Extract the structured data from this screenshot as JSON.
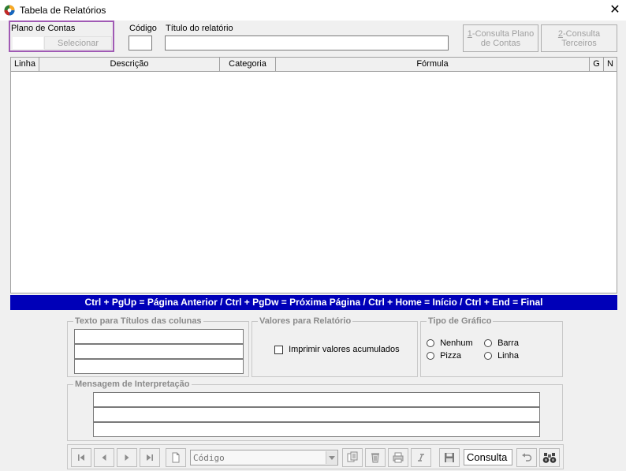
{
  "window": {
    "title": "Tabela de Relatórios",
    "close_glyph": "✕"
  },
  "header": {
    "plano_label": "Plano de Contas",
    "selecionar_label": "Selecionar",
    "codigo_label": "Código",
    "titulo_label": "Título do relatório",
    "codigo_value": "",
    "titulo_value": "",
    "consulta_plano": {
      "hotkey": "1",
      "line1_rest": "-Consulta Plano",
      "line2": "de Contas"
    },
    "consulta_terceiros": {
      "hotkey": "2",
      "line1_rest": "-Consulta",
      "line2": "Terceiros"
    }
  },
  "grid": {
    "columns": [
      "Linha",
      "Descrição",
      "Categoria",
      "Fórmula",
      "G",
      "N"
    ]
  },
  "hint": "Ctrl + PgUp = Página Anterior / Ctrl + PgDw = Próxima Página / Ctrl + Home = Início / Ctrl + End = Final",
  "groups": {
    "texto_titulos": "Texto para Títulos das colunas",
    "valores": "Valores para Relatório",
    "imprimir_label": "Imprimir valores acumulados",
    "tipo_grafico": "Tipo de Gráfico",
    "radios": [
      "Nenhum",
      "Barra",
      "Pizza",
      "Linha"
    ],
    "mensagem": "Mensagem de Interpretação"
  },
  "toolbar": {
    "search_placeholder": "Código",
    "mode_label": "Consulta"
  },
  "icons": [
    "app-icon",
    "first-icon",
    "prev-icon",
    "next-icon",
    "last-icon",
    "new-document-icon",
    "dropdown-icon",
    "copy-icon",
    "delete-icon",
    "print-icon",
    "italic-icon",
    "save-icon",
    "undo-icon",
    "binoculars-icon"
  ]
}
